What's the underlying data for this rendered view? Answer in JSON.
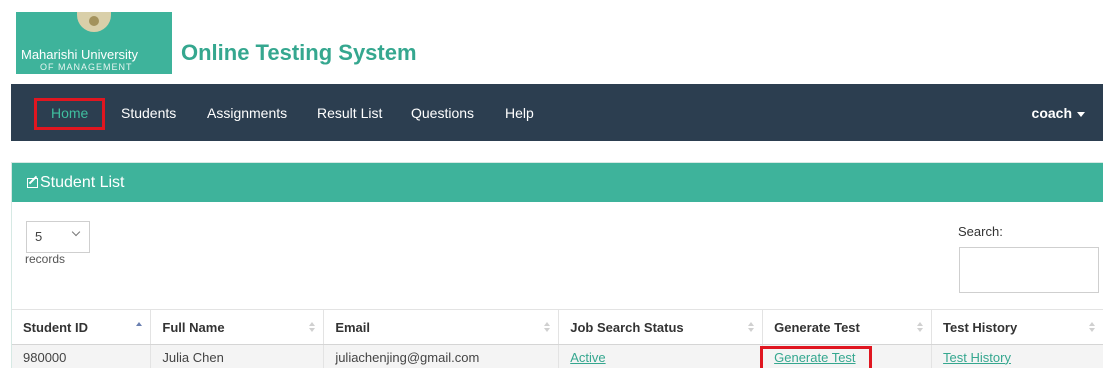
{
  "header": {
    "logo_line1": "Maharishi University",
    "logo_line2": "OF MANAGEMENT",
    "app_title": "Online Testing System"
  },
  "nav": {
    "items": [
      "Home",
      "Students",
      "Assignments",
      "Result List",
      "Questions",
      "Help"
    ],
    "user": "coach",
    "active": "Home",
    "highlight_color": "#e01620"
  },
  "panel": {
    "title": "Student List",
    "page_size": "5",
    "records_label": "records",
    "search_label": "Search:",
    "search_value": ""
  },
  "table": {
    "columns": [
      "Student ID",
      "Full Name",
      "Email",
      "Job Search Status",
      "Generate Test",
      "Test History"
    ],
    "rows": [
      {
        "student_id": "980000",
        "full_name": "Julia Chen",
        "email": "juliachenjing@gmail.com",
        "job_search_status": "Active",
        "generate_test": "Generate Test",
        "test_history": "Test History"
      }
    ]
  },
  "colors": {
    "brand_green": "#3eb39b",
    "navbar": "#2c3e50",
    "link": "#35a78f",
    "annotation_red": "#e01620"
  }
}
